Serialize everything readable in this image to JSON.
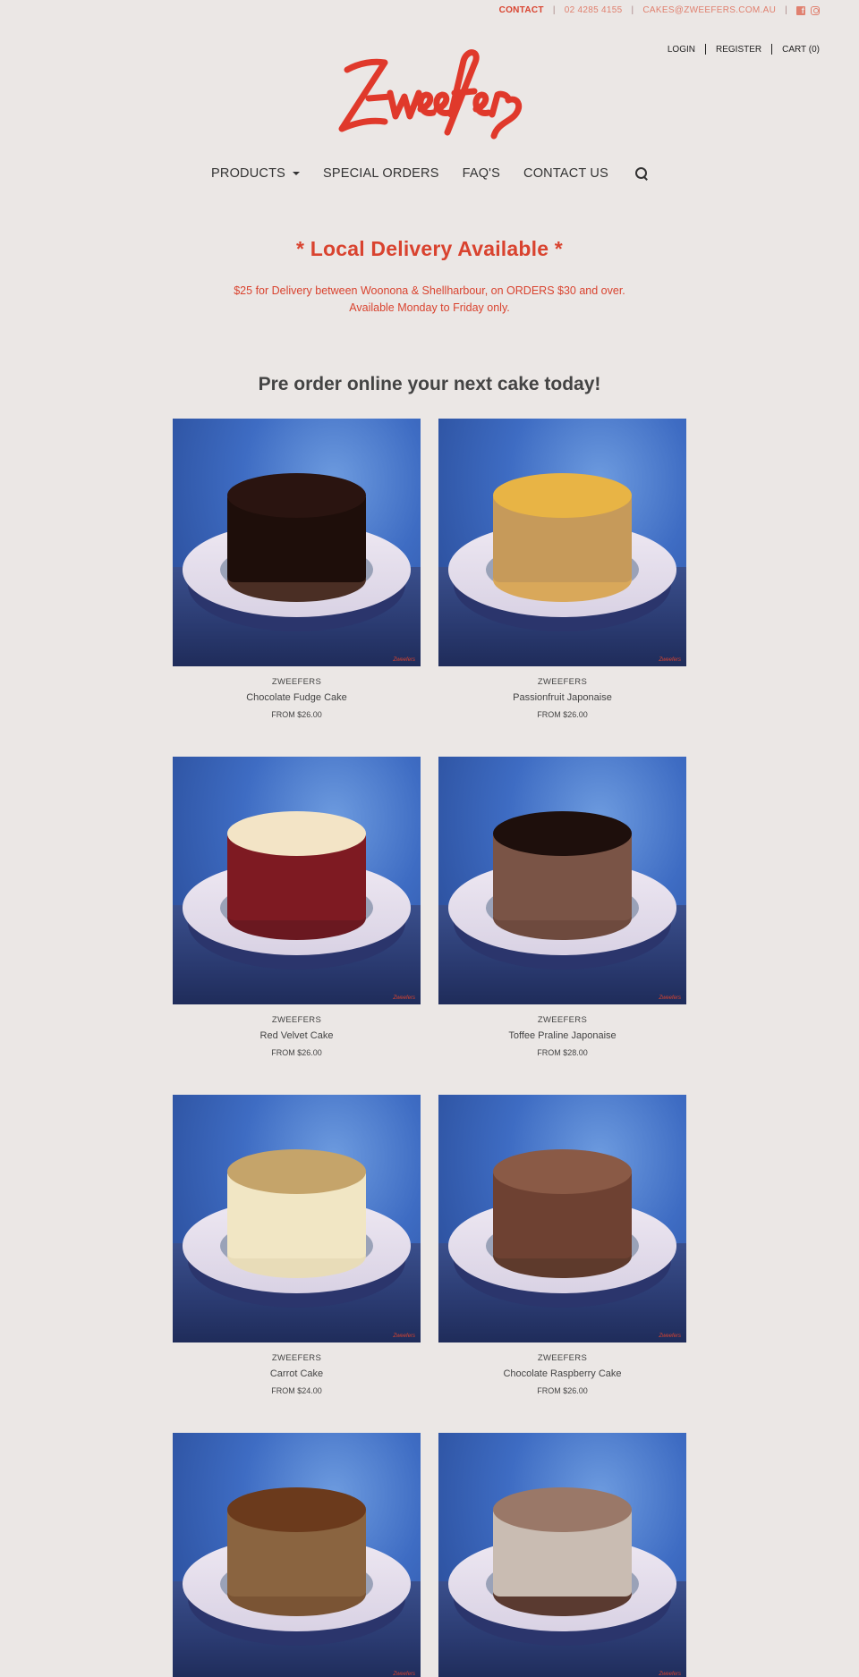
{
  "topbar": {
    "contact_label": "CONTACT",
    "phone": "02 4285 4155",
    "email": "CAKES@ZWEEFERS.COM.AU",
    "sep": "|",
    "icons": [
      "facebook-icon",
      "instagram-icon"
    ]
  },
  "account": {
    "login": "LOGIN",
    "register": "REGISTER",
    "cart": "CART (0)"
  },
  "logo": {
    "text": "Zweefers"
  },
  "nav": {
    "products": "PRODUCTS",
    "special_orders": "SPECIAL ORDERS",
    "faqs": "FAQ'S",
    "contact_us": "CONTACT US"
  },
  "banner": {
    "title": "* Local Delivery Available *",
    "line1": "$25 for Delivery between Woonona & Shellharbour, on ORDERS $30 and over.",
    "line2": "Available Monday to Friday only."
  },
  "section_title": "Pre order online your next cake today!",
  "products": [
    {
      "brand": "ZWEEFERS",
      "name": "Chocolate Fudge Cake",
      "price": "FROM $26.00",
      "top": "#2a1410",
      "body": "#1e0e0a",
      "base": "#4a2e24"
    },
    {
      "brand": "ZWEEFERS",
      "name": "Passionfruit Japonaise",
      "price": "FROM $26.00",
      "top": "#e8b445",
      "body": "#c69a5a",
      "base": "#d9a85a"
    },
    {
      "brand": "ZWEEFERS",
      "name": "Red Velvet Cake",
      "price": "FROM $26.00",
      "top": "#f3e4c6",
      "body": "#7e1a22",
      "base": "#6a1820"
    },
    {
      "brand": "ZWEEFERS",
      "name": "Toffee Praline Japonaise",
      "price": "FROM $28.00",
      "top": "#1e0f0c",
      "body": "#7a5446",
      "base": "#6e4a3e"
    },
    {
      "brand": "ZWEEFERS",
      "name": "Carrot Cake",
      "price": "FROM $24.00",
      "top": "#c5a46a",
      "body": "#f1e6c4",
      "base": "#e8dcb8"
    },
    {
      "brand": "ZWEEFERS",
      "name": "Chocolate Raspberry Cake",
      "price": "FROM $26.00",
      "top": "#8a5a46",
      "body": "#6e4132",
      "base": "#5e3a2c"
    },
    {
      "brand": "",
      "name": "",
      "price": "",
      "top": "#6b3a1c",
      "body": "#8a6440",
      "base": "#7a5434"
    },
    {
      "brand": "",
      "name": "",
      "price": "",
      "top": "#9a7868",
      "body": "#c9bcb2",
      "base": "#5a3a30"
    }
  ]
}
